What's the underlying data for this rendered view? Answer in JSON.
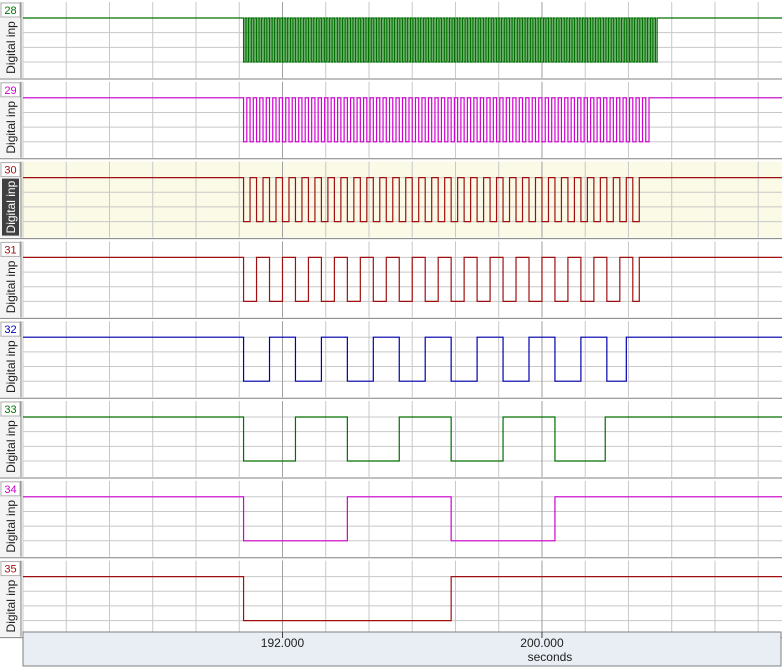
{
  "chart_data": {
    "type": "line",
    "x_axis": {
      "unit_label": "seconds",
      "ticks": [
        192.0,
        200.0
      ],
      "tick_labels": [
        "192.000",
        "200.000"
      ],
      "range": [
        184.0,
        207.4
      ]
    },
    "channel_axis_label": "Digital inp",
    "series": [
      {
        "name": "28",
        "color": "#007000",
        "highlighted": false,
        "high_before": true,
        "start": 190.8,
        "end": 203.55,
        "period": 0.1,
        "first_value": 0,
        "last_value": 1
      },
      {
        "name": "29",
        "color": "#d000d0",
        "highlighted": false,
        "high_before": true,
        "start": 190.8,
        "end": 203.4,
        "period": 0.2,
        "first_value": 0,
        "last_value": 1
      },
      {
        "name": "30",
        "color": "#a01010",
        "highlighted": true,
        "high_before": true,
        "start": 190.8,
        "end": 203.2,
        "period": 0.4,
        "first_value": 0,
        "last_value": 1
      },
      {
        "name": "31",
        "color": "#a01010",
        "highlighted": false,
        "high_before": true,
        "start": 190.8,
        "end": 203.0,
        "period": 0.8,
        "first_value": 0,
        "last_value": 1
      },
      {
        "name": "32",
        "color": "#0000b0",
        "highlighted": false,
        "high_before": true,
        "start": 190.8,
        "end": 202.6,
        "period": 1.6,
        "first_value": 0,
        "last_value": 1
      },
      {
        "name": "33",
        "color": "#007000",
        "highlighted": false,
        "high_before": true,
        "start": 190.8,
        "end": 201.95,
        "period": 3.2,
        "first_value": 0,
        "last_value": 1
      },
      {
        "name": "34",
        "color": "#d000d0",
        "highlighted": false,
        "high_before": true,
        "start": 190.8,
        "end": 200.45,
        "period": 6.4,
        "first_value": 0,
        "last_value": 1
      },
      {
        "name": "35",
        "color": "#a01010",
        "highlighted": false,
        "high_before": true,
        "start": 190.8,
        "end": 197.2,
        "period": 12.8,
        "first_value": 0,
        "last_value": 1
      }
    ],
    "grid": true,
    "colors": {
      "grid": "#c8c8c8",
      "border": "#808080",
      "label_bg": "#404040",
      "highlight_bg": "#fafae6",
      "axis_bg": "#e8eef4"
    }
  }
}
